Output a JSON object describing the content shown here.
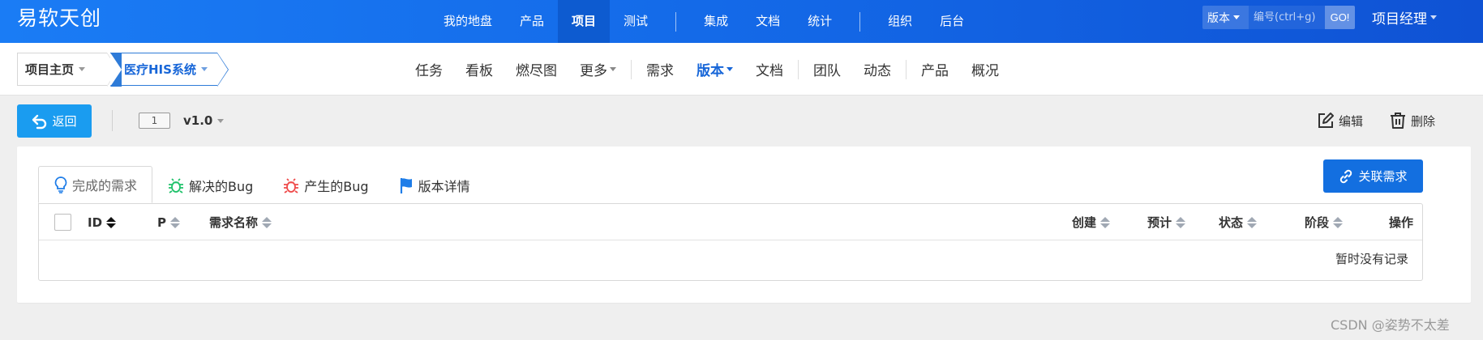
{
  "brand": "易软天创",
  "main_nav": {
    "group1": [
      "我的地盘",
      "产品",
      "项目",
      "测试"
    ],
    "group2": [
      "集成",
      "文档",
      "统计"
    ],
    "group3": [
      "组织",
      "后台"
    ],
    "active": "项目"
  },
  "search": {
    "type_label": "版本",
    "placeholder": "编号(ctrl+g)",
    "go_label": "GO!"
  },
  "user_role": "项目经理",
  "breadcrumb": {
    "home": "项目主页",
    "project": "医疗HIS系统"
  },
  "sub_nav": {
    "group1": [
      "任务",
      "看板",
      "燃尽图",
      "更多"
    ],
    "group2": [
      "需求",
      "版本",
      "文档"
    ],
    "group3": [
      "团队",
      "动态"
    ],
    "group4": [
      "产品",
      "概况"
    ],
    "active": "版本"
  },
  "toolbar": {
    "back_label": "返回",
    "version_id": "1",
    "version_name": "v1.0",
    "edit_label": "编辑",
    "delete_label": "删除"
  },
  "tabs": [
    {
      "label": "完成的需求",
      "icon": "lightbulb-icon",
      "active": true
    },
    {
      "label": "解决的Bug",
      "icon": "bug-icon",
      "color": "#20c26b"
    },
    {
      "label": "产生的Bug",
      "icon": "bug-icon",
      "color": "#ef4b4b"
    },
    {
      "label": "版本详情",
      "icon": "flag-icon",
      "color": "#1e7de8"
    }
  ],
  "link_story_label": "关联需求",
  "table": {
    "columns": [
      "ID",
      "P",
      "需求名称",
      "创建",
      "预计",
      "状态",
      "阶段",
      "操作"
    ],
    "empty_message": "暂时没有记录"
  },
  "watermark": "CSDN @姿势不太差",
  "colors": {
    "topbar_start": "#1a7cf5",
    "topbar_end": "#0f52d4",
    "accent": "#1766d8",
    "back_button": "#1a9cf0"
  }
}
